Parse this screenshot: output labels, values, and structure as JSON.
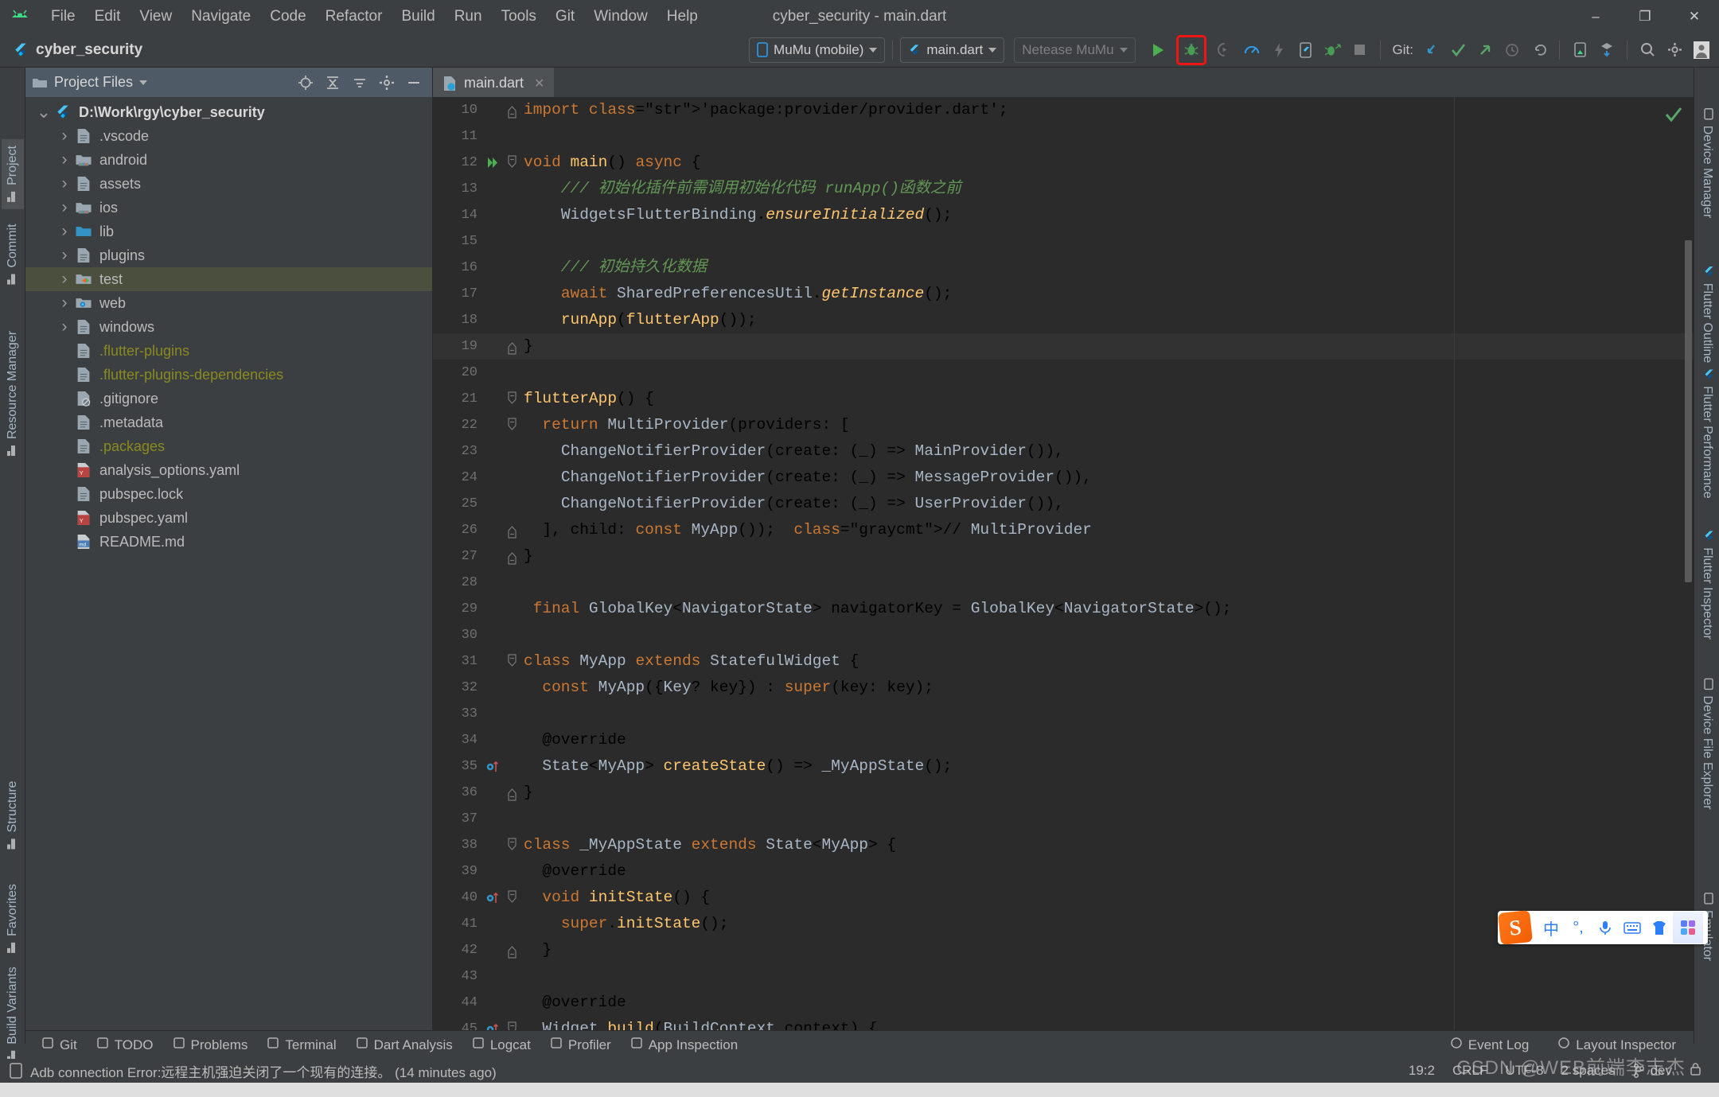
{
  "window": {
    "title": "cyber_security - main.dart",
    "minimize": "–",
    "maximize": "❐",
    "close": "✕"
  },
  "menubar": {
    "logo_icon": "android-logo-icon",
    "items": [
      "File",
      "Edit",
      "View",
      "Navigate",
      "Code",
      "Refactor",
      "Build",
      "Run",
      "Tools",
      "Git",
      "Window",
      "Help"
    ]
  },
  "toolbar": {
    "project_name": "cyber_security",
    "device_selector": "MuMu (mobile)",
    "config_selector": "main.dart",
    "emulator_selector": "Netease MuMu",
    "git_label": "Git:",
    "icons": [
      "run-icon",
      "debug-icon",
      "run-coverage-icon",
      "profile-icon",
      "hot-reload-icon",
      "flutter-device-icon",
      "attach-debugger-icon",
      "stop-icon"
    ],
    "git_icons": [
      "update-project-icon",
      "commit-icon",
      "push-icon",
      "history-icon",
      "rollback-icon"
    ],
    "right_icons": [
      "device-manager-icon",
      "sdk-manager-icon",
      "search-everywhere-icon",
      "settings-icon",
      "account-icon"
    ]
  },
  "left_toolwindows": [
    {
      "label": "Project",
      "icon": "project-icon",
      "active": true
    },
    {
      "label": "Commit",
      "icon": "commit-icon",
      "active": false
    },
    {
      "label": "Resource Manager",
      "icon": "resource-manager-icon",
      "active": false
    },
    {
      "label": "Structure",
      "icon": "structure-icon",
      "active": false
    },
    {
      "label": "Favorites",
      "icon": "star-icon",
      "active": false
    },
    {
      "label": "Build Variants",
      "icon": "build-variants-icon",
      "active": false
    }
  ],
  "right_toolwindows": [
    {
      "label": "Device Manager",
      "icon": "device-manager-icon"
    },
    {
      "label": "Flutter Outline",
      "icon": "flutter-icon"
    },
    {
      "label": "Flutter Performance",
      "icon": "flutter-icon"
    },
    {
      "label": "Flutter Inspector",
      "icon": "flutter-icon"
    },
    {
      "label": "Device File Explorer",
      "icon": "phone-icon"
    },
    {
      "label": "Emulator",
      "icon": "emulator-icon"
    }
  ],
  "project_panel": {
    "header_title": "Project Files",
    "header_icons": [
      "locate-icon",
      "collapse-all-icon",
      "expand-icon",
      "settings-icon",
      "hide-icon"
    ],
    "tree": [
      {
        "name": "D:\\Work\\rgy\\cyber_security",
        "icon": "flutter-icon",
        "arrow": "expanded",
        "depth": 0,
        "type": "root"
      },
      {
        "name": ".vscode",
        "icon": "folder-icon",
        "arrow": "collapsed",
        "depth": 1,
        "type": "folder"
      },
      {
        "name": "android",
        "icon": "folder-android-icon",
        "arrow": "collapsed",
        "depth": 1,
        "type": "folder"
      },
      {
        "name": "assets",
        "icon": "folder-icon",
        "arrow": "collapsed",
        "depth": 1,
        "type": "folder"
      },
      {
        "name": "ios",
        "icon": "folder-ios-icon",
        "arrow": "collapsed",
        "depth": 1,
        "type": "folder"
      },
      {
        "name": "lib",
        "icon": "folder-source-icon",
        "arrow": "collapsed",
        "depth": 1,
        "type": "folder"
      },
      {
        "name": "plugins",
        "icon": "folder-icon",
        "arrow": "collapsed",
        "depth": 1,
        "type": "folder"
      },
      {
        "name": "test",
        "icon": "folder-test-icon",
        "arrow": "collapsed",
        "depth": 1,
        "type": "folder",
        "selected": true
      },
      {
        "name": "web",
        "icon": "folder-web-icon",
        "arrow": "collapsed",
        "depth": 1,
        "type": "folder"
      },
      {
        "name": "windows",
        "icon": "folder-icon",
        "arrow": "collapsed",
        "depth": 1,
        "type": "folder"
      },
      {
        "name": ".flutter-plugins",
        "icon": "file-text-icon",
        "arrow": "none",
        "depth": 1,
        "type": "file",
        "color": "olive"
      },
      {
        "name": ".flutter-plugins-dependencies",
        "icon": "file-text-icon",
        "arrow": "none",
        "depth": 1,
        "type": "file",
        "color": "olive"
      },
      {
        "name": ".gitignore",
        "icon": "file-ignore-icon",
        "arrow": "none",
        "depth": 1,
        "type": "file"
      },
      {
        "name": ".metadata",
        "icon": "file-text-icon",
        "arrow": "none",
        "depth": 1,
        "type": "file"
      },
      {
        "name": ".packages",
        "icon": "file-text-icon",
        "arrow": "none",
        "depth": 1,
        "type": "file",
        "color": "olive"
      },
      {
        "name": "analysis_options.yaml",
        "icon": "file-yaml-icon",
        "arrow": "none",
        "depth": 1,
        "type": "file"
      },
      {
        "name": "pubspec.lock",
        "icon": "file-text-icon",
        "arrow": "none",
        "depth": 1,
        "type": "file"
      },
      {
        "name": "pubspec.yaml",
        "icon": "file-yaml-icon",
        "arrow": "none",
        "depth": 1,
        "type": "file"
      },
      {
        "name": "README.md",
        "icon": "file-md-icon",
        "arrow": "none",
        "depth": 1,
        "type": "file"
      }
    ]
  },
  "editor": {
    "tab": {
      "label": "main.dart",
      "icon": "dart-file-icon",
      "close": "✕"
    },
    "first_line_number": 10,
    "inspection_status": "ok-check-icon",
    "lines": [
      {
        "n": 10,
        "fold": "end",
        "text": "import 'package:provider/provider.dart';"
      },
      {
        "n": 11,
        "text": ""
      },
      {
        "n": 12,
        "gutter": "run-gutter-icon",
        "fold": "start",
        "text": "void main() async {"
      },
      {
        "n": 13,
        "text": "    /// 初始化插件前需调用初始化代码 runApp()函数之前"
      },
      {
        "n": 14,
        "text": "    WidgetsFlutterBinding.ensureInitialized();"
      },
      {
        "n": 15,
        "text": ""
      },
      {
        "n": 16,
        "text": "    /// 初始持久化数据"
      },
      {
        "n": 17,
        "text": "    await SharedPreferencesUtil.getInstance();"
      },
      {
        "n": 18,
        "text": "    runApp(flutterApp());"
      },
      {
        "n": 19,
        "fold": "end",
        "text": "}",
        "current": true
      },
      {
        "n": 20,
        "text": ""
      },
      {
        "n": 21,
        "fold": "start",
        "text": "flutterApp() {"
      },
      {
        "n": 22,
        "fold": "start",
        "text": "  return MultiProvider(providers: ["
      },
      {
        "n": 23,
        "text": "    ChangeNotifierProvider(create: (_) => MainProvider()),"
      },
      {
        "n": 24,
        "text": "    ChangeNotifierProvider(create: (_) => MessageProvider()),"
      },
      {
        "n": 25,
        "text": "    ChangeNotifierProvider(create: (_) => UserProvider()),"
      },
      {
        "n": 26,
        "fold": "end",
        "text": "  ], child: const MyApp());  // MultiProvider"
      },
      {
        "n": 27,
        "fold": "end",
        "text": "}"
      },
      {
        "n": 28,
        "text": ""
      },
      {
        "n": 29,
        "text": " final GlobalKey<NavigatorState> navigatorKey = GlobalKey<NavigatorState>();"
      },
      {
        "n": 30,
        "text": ""
      },
      {
        "n": 31,
        "fold": "start",
        "text": "class MyApp extends StatefulWidget {"
      },
      {
        "n": 32,
        "text": "  const MyApp({Key? key}) : super(key: key);"
      },
      {
        "n": 33,
        "text": ""
      },
      {
        "n": 34,
        "text": "  @override"
      },
      {
        "n": 35,
        "gutter": "override-gutter-icon",
        "text": "  State<MyApp> createState() => _MyAppState();"
      },
      {
        "n": 36,
        "fold": "end",
        "text": "}"
      },
      {
        "n": 37,
        "text": ""
      },
      {
        "n": 38,
        "fold": "start",
        "text": "class _MyAppState extends State<MyApp> {"
      },
      {
        "n": 39,
        "text": "  @override"
      },
      {
        "n": 40,
        "gutter": "override-gutter-icon",
        "fold": "start",
        "text": "  void initState() {"
      },
      {
        "n": 41,
        "text": "    super.initState();"
      },
      {
        "n": 42,
        "fold": "end",
        "text": "  }"
      },
      {
        "n": 43,
        "text": ""
      },
      {
        "n": 44,
        "text": "  @override"
      },
      {
        "n": 45,
        "gutter": "override-gutter-icon",
        "fold": "start",
        "text": "  Widget build(BuildContext context) {"
      }
    ]
  },
  "bottom_toolwindows": [
    {
      "label": "Git",
      "icon": "git-branch-icon"
    },
    {
      "label": "TODO",
      "icon": "todo-icon"
    },
    {
      "label": "Problems",
      "icon": "problems-icon"
    },
    {
      "label": "Terminal",
      "icon": "terminal-icon"
    },
    {
      "label": "Dart Analysis",
      "icon": "dart-icon"
    },
    {
      "label": "Logcat",
      "icon": "logcat-icon"
    },
    {
      "label": "Profiler",
      "icon": "profiler-icon"
    },
    {
      "label": "App Inspection",
      "icon": "app-inspection-icon"
    }
  ],
  "bottom_right_toolwindows": [
    {
      "label": "Event Log",
      "icon": "event-log-icon"
    },
    {
      "label": "Layout Inspector",
      "icon": "layout-inspector-icon"
    }
  ],
  "statusbar": {
    "message": "Adb connection Error:远程主机强迫关闭了一个现有的连接。 (14 minutes ago)",
    "message_icon": "device-icon",
    "caret": "19:2",
    "line_separator": "CRLF",
    "encoding": "UTF-8",
    "indent": "2 spaces",
    "branch": "dev",
    "branch_icon": "git-branch-icon",
    "lock_icon": "lock-icon"
  },
  "ime": {
    "logo": "S",
    "buttons": [
      "中",
      "°,",
      "mic-icon",
      "keyboard-icon",
      "skin-icon",
      "apps-icon"
    ]
  },
  "watermark": "CSDN @WEB前端李志杰",
  "colors": {
    "accent_blue": "#3c8ce7",
    "debug_highlight": "#f01414",
    "selection_green": "#4a4f3e",
    "editor_bg": "#2b2b2b",
    "panel_bg": "#3c3f41"
  }
}
